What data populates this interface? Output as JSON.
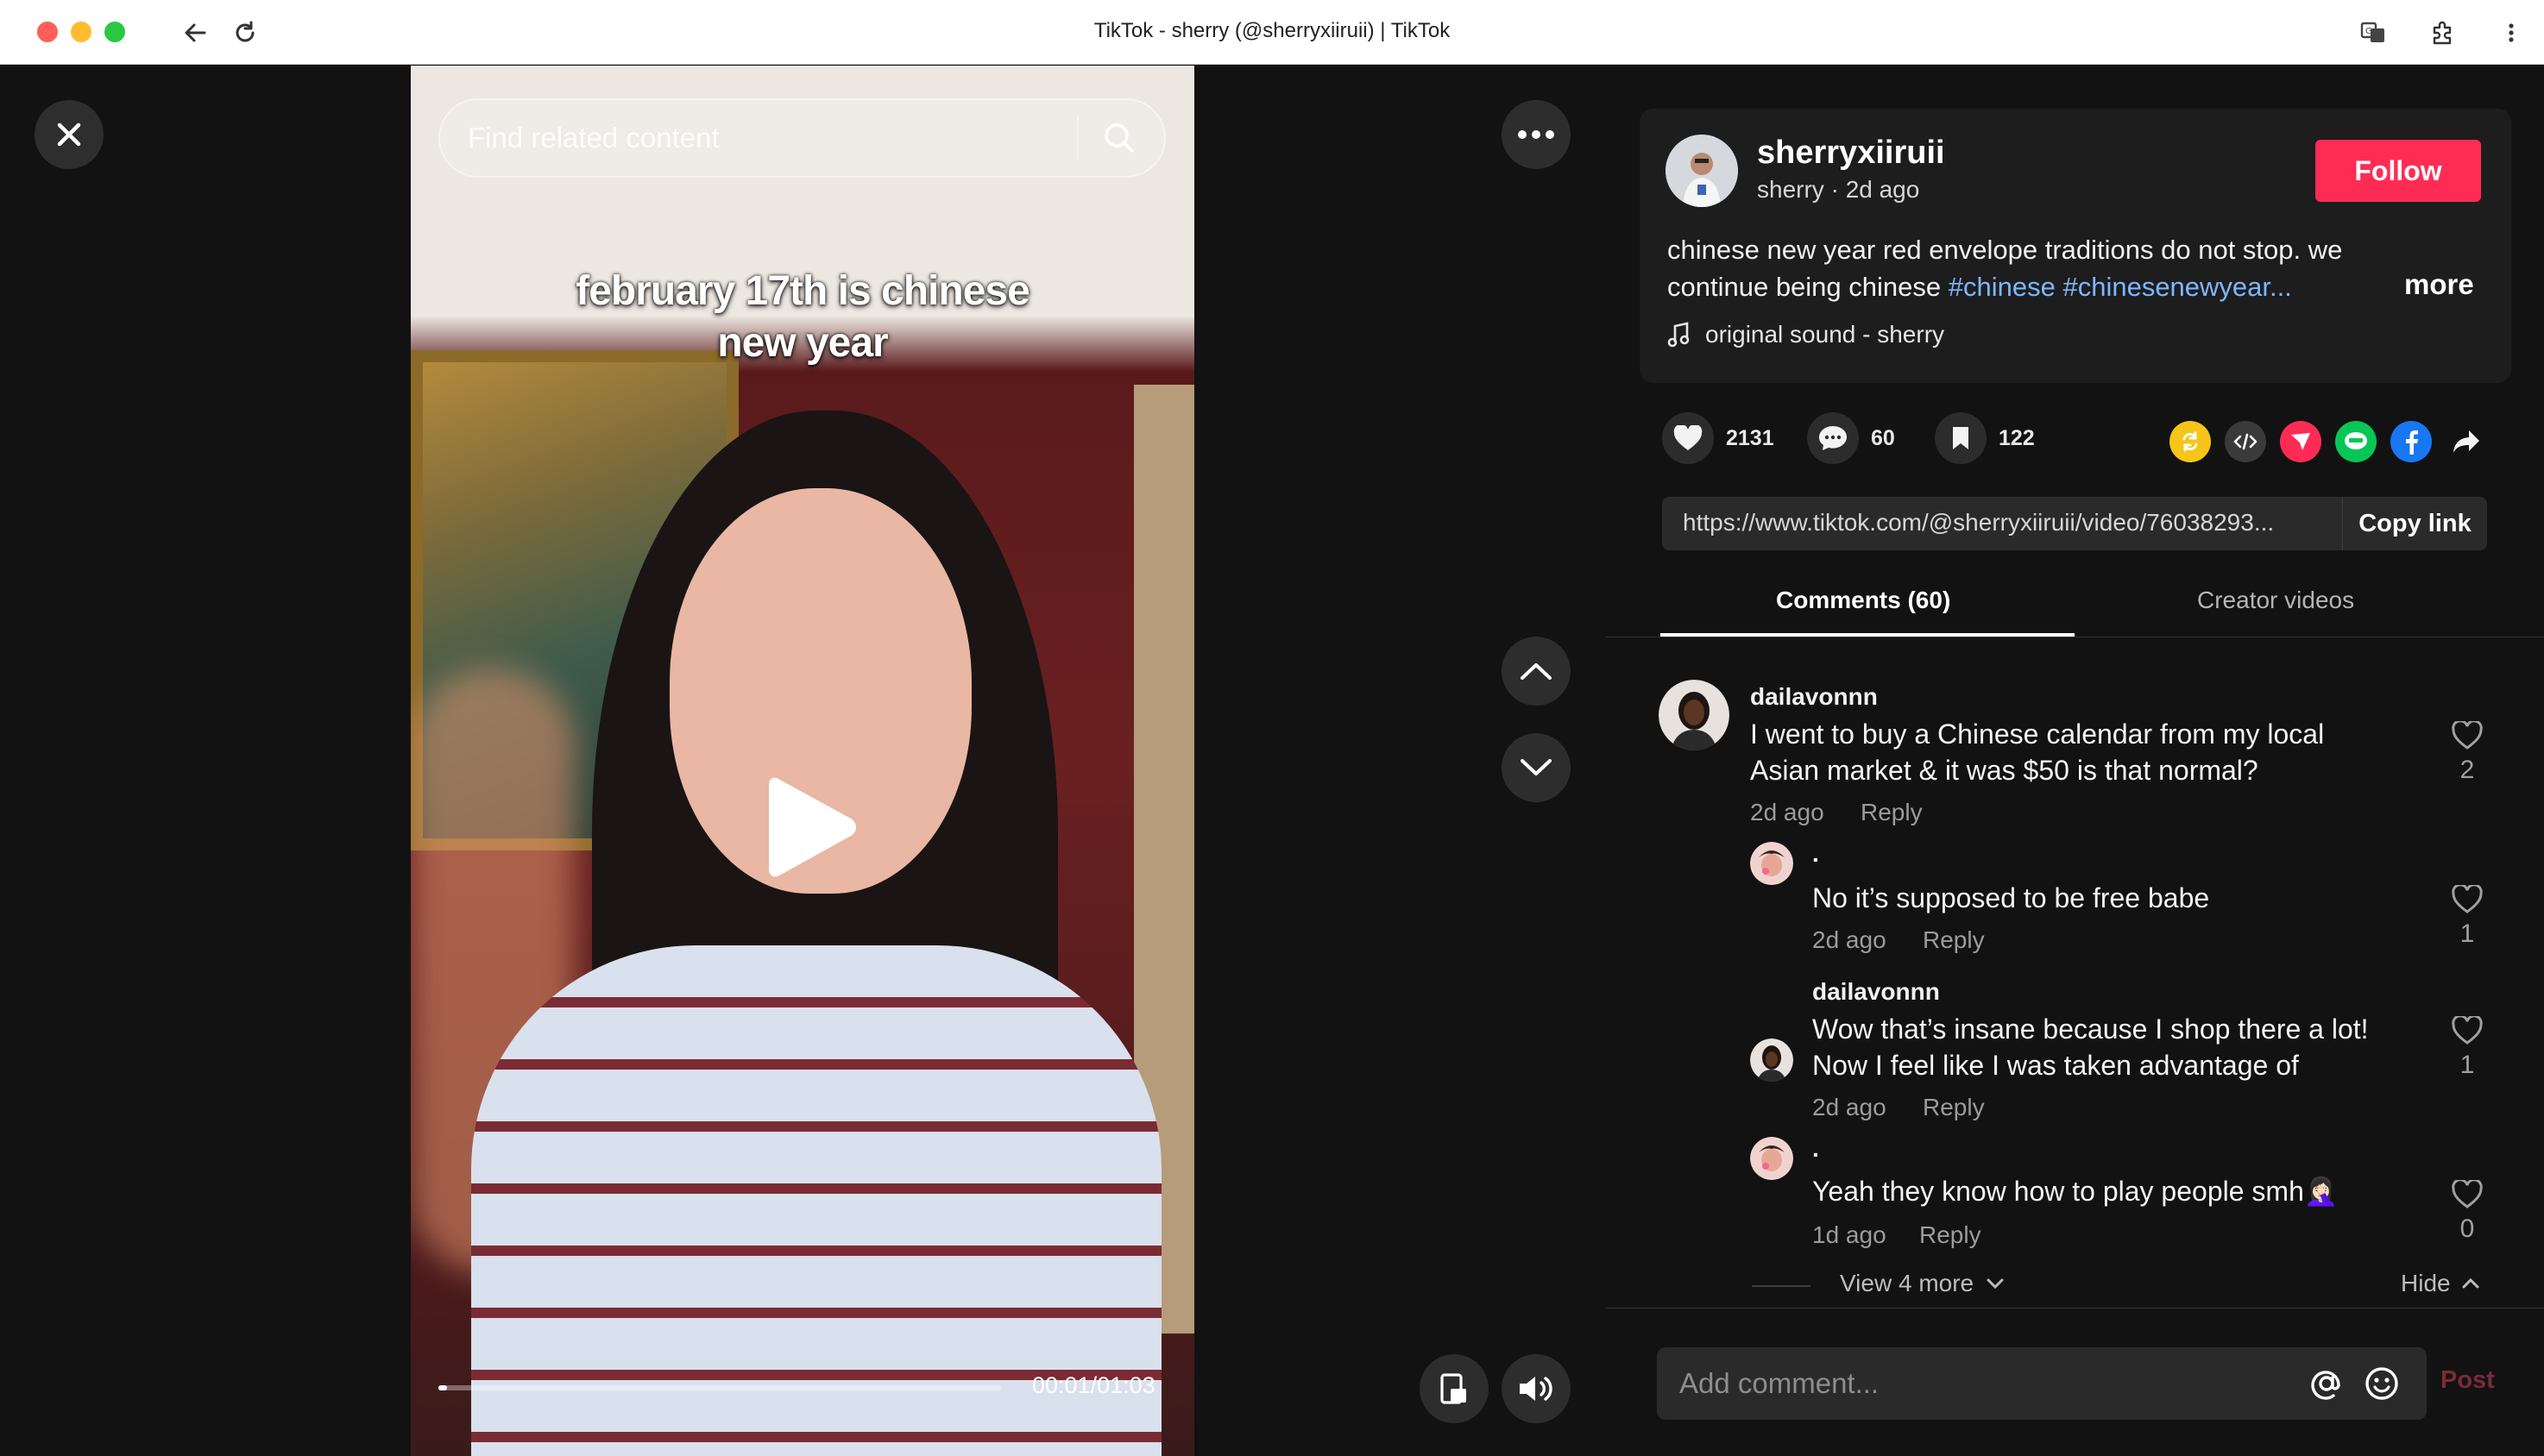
{
  "browser": {
    "window_title": "TikTok - sherry (@sherryxiiruii) | TikTok"
  },
  "video": {
    "search_placeholder": "Find related content",
    "caption_line1": "february 17th is chinese",
    "caption_line2": "new year",
    "progress_fraction": 0.016,
    "time": "00:01/01:03"
  },
  "author": {
    "username": "sherryxiiruii",
    "nickname": "sherry",
    "posted": "2d ago",
    "meta_separator": " · ",
    "follow_label": "Follow"
  },
  "post": {
    "description_line1": "chinese new year red envelope traditions do not stop. we",
    "description_line2": "continue being chinese ",
    "hashtag1": "#chinese",
    "hashtag2": "#chinesenewyear...",
    "more_label": "more",
    "sound": "original sound - sherry"
  },
  "actions": {
    "likes": "2131",
    "comments": "60",
    "saves": "122"
  },
  "share": {
    "link": "https://www.tiktok.com/@sherryxiiruii/video/76038293...",
    "copy_label": "Copy link"
  },
  "tabs": {
    "comments_label": "Comments (60)",
    "creator_label": "Creator videos"
  },
  "comments": [
    {
      "user": "dailavonnn",
      "line1": "I went to buy a Chinese calendar from my local",
      "line2": "Asian market & it was $50 is that normal?",
      "time": "2d ago",
      "reply": "Reply",
      "likes": "2"
    },
    {
      "user": ".",
      "line1": "No it’s supposed to be free babe",
      "time": "2d ago",
      "reply": "Reply",
      "likes": "1"
    },
    {
      "user": "dailavonnn",
      "line1": "Wow that’s insane because I shop there a lot!",
      "line2": "Now I feel like I was taken advantage of",
      "time": "2d ago",
      "reply": "Reply",
      "likes": "1"
    },
    {
      "user": ".",
      "line1": "Yeah they know how to play people smh🤦🏻‍♀️",
      "time": "1d ago",
      "reply": "Reply",
      "likes": "0"
    }
  ],
  "thread": {
    "view_more": "View 4 more",
    "hide": "Hide"
  },
  "composer": {
    "placeholder": "Add comment...",
    "post_label": "Post"
  },
  "colors": {
    "accent": "#fe2c55",
    "hashtag": "#7fb6ff",
    "background": "#121212"
  }
}
